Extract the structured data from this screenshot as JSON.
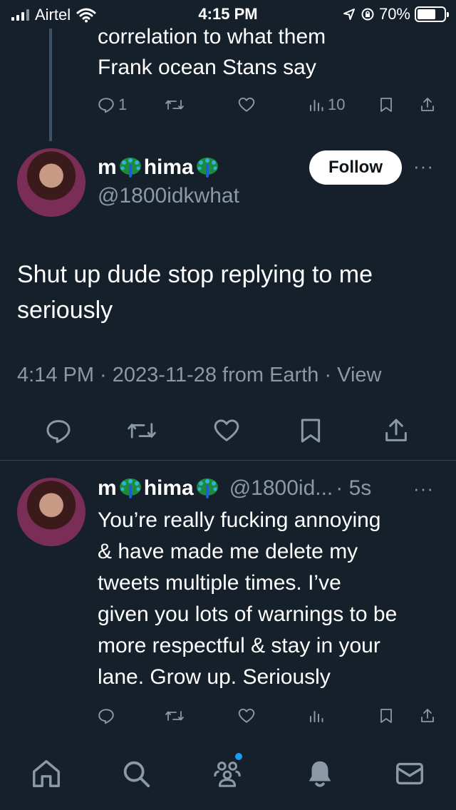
{
  "status_bar": {
    "carrier": "Airtel",
    "time": "4:15 PM",
    "battery": "70%",
    "battery_level": 0.7
  },
  "parent_tweet": {
    "text_line1": "correlation to what them",
    "text_line2": "Frank ocean Stans say",
    "reply_count": "1",
    "view_count": "10"
  },
  "main_tweet": {
    "name_start": "m",
    "name_end": "hima",
    "handle": "@1800idkwhat",
    "follow_label": "Follow",
    "text": "Shut up dude stop replying to me seriously",
    "meta": "4:14 PM · 2023-11-28 from Earth · View"
  },
  "reply_tweet": {
    "name_start": "m",
    "name_end": "hima",
    "handle": "@1800id...",
    "age": "· 5s",
    "text_lines": [
      "You’re really fucking annoying",
      "& have made me delete my",
      "tweets multiple times. I’ve",
      "given you lots of warnings to be",
      "more respectful & stay in your",
      "lane. Grow up. Seriously"
    ]
  },
  "more_label": "···",
  "colors": {
    "background": "#15202b",
    "muted": "#8b98a5",
    "accent": "#1d9bf0",
    "divider": "#38444d"
  },
  "icons": {
    "nav": [
      "home-icon",
      "search-icon",
      "communities-icon",
      "notifications-icon",
      "messages-icon"
    ],
    "actions": [
      "reply-icon",
      "retweet-icon",
      "like-icon",
      "views-icon",
      "bookmark-icon",
      "share-icon"
    ]
  }
}
